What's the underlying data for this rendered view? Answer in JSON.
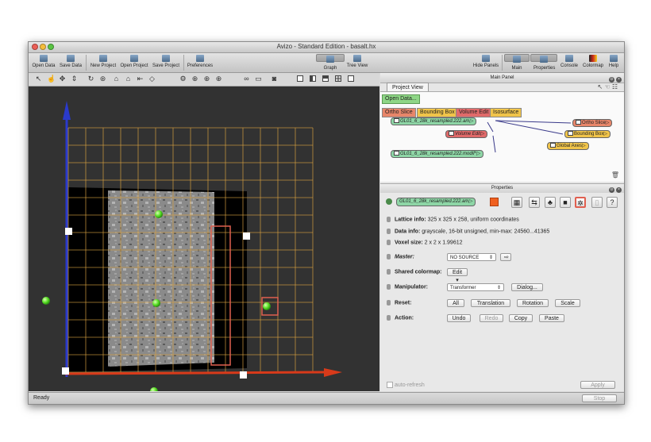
{
  "window": {
    "title": "Avizo - Standard Edition - basalt.hx"
  },
  "toolbar": {
    "left": [
      {
        "label": "Open Data",
        "icon": "open-data-icon"
      },
      {
        "label": "Save Data",
        "icon": "save-data-icon"
      },
      {
        "label": "New Project",
        "icon": "new-project-icon"
      },
      {
        "label": "Open Project",
        "icon": "open-project-icon"
      },
      {
        "label": "Save Project",
        "icon": "save-project-icon"
      },
      {
        "label": "Preferences",
        "icon": "preferences-icon"
      }
    ],
    "views": [
      {
        "label": "Graph View",
        "icon": "graph-view-icon",
        "selected": true
      },
      {
        "label": "Tree View",
        "icon": "tree-view-icon",
        "selected": false
      }
    ],
    "right": [
      {
        "label": "Hide Panels",
        "icon": "hide-panels-icon",
        "selected": false
      },
      {
        "label": "Main Panel",
        "icon": "main-panel-icon",
        "selected": true
      },
      {
        "label": "Properties",
        "icon": "properties-icon",
        "selected": true
      },
      {
        "label": "Console",
        "icon": "console-icon",
        "selected": false
      },
      {
        "label": "Colormap",
        "icon": "colormap-icon",
        "selected": false
      },
      {
        "label": "Help",
        "icon": "help-icon",
        "selected": false
      }
    ]
  },
  "main_panel": {
    "title": "Main Panel",
    "tab": "Project View",
    "open_data": "Open Data...",
    "modules": [
      {
        "label": "Ortho Slice",
        "color": "#e8866a"
      },
      {
        "label": "Bounding Box",
        "color": "#f0c44a"
      },
      {
        "label": "Volume Edit",
        "color": "#e06a6a"
      },
      {
        "label": "Isosurface",
        "color": "#f0c44a"
      }
    ],
    "nodes": {
      "data1": "GL01_6_28k_resampled.222.am",
      "volume_edit": "Volume Edit",
      "data2": "GL01_6_28k_resampled.222.modif",
      "ortho": "Ortho Slice",
      "bbox": "Bounding Box",
      "axes": "Global Axes"
    }
  },
  "properties": {
    "title": "Properties",
    "object": "GL01_6_28k_resampled.222.am",
    "lattice_label": "Lattice info:",
    "lattice_value": "325 x 325 x 258, uniform coordinates",
    "data_label": "Data info:",
    "data_value": "grayscale, 16-bit unsigned, min-max: 24560...41365",
    "voxel_label": "Voxel size:",
    "voxel_value": "2 x 2 x 1.99612",
    "master_label": "Master:",
    "master_value": "NO SOURCE",
    "colormap_label": "Shared colormap:",
    "colormap_btn": "Edit",
    "manip_label": "Manipulator:",
    "manip_value": "Transformer",
    "dialog_btn": "Dialog...",
    "reset_label": "Reset:",
    "reset_buttons": [
      "All",
      "Translation",
      "Rotation",
      "Scale"
    ],
    "action_label": "Action:",
    "action_buttons": [
      "Undo",
      "Redo",
      "Copy",
      "Paste"
    ],
    "auto_refresh": "auto-refresh",
    "apply": "Apply"
  },
  "status": {
    "text": "Ready",
    "stop": "Stop"
  },
  "colors": {
    "grid": "#d9a040",
    "x_axis": "#d83a1a",
    "y_axis": "#2a3acc",
    "sphere": "#55dd22",
    "highlight": "#e06050"
  }
}
